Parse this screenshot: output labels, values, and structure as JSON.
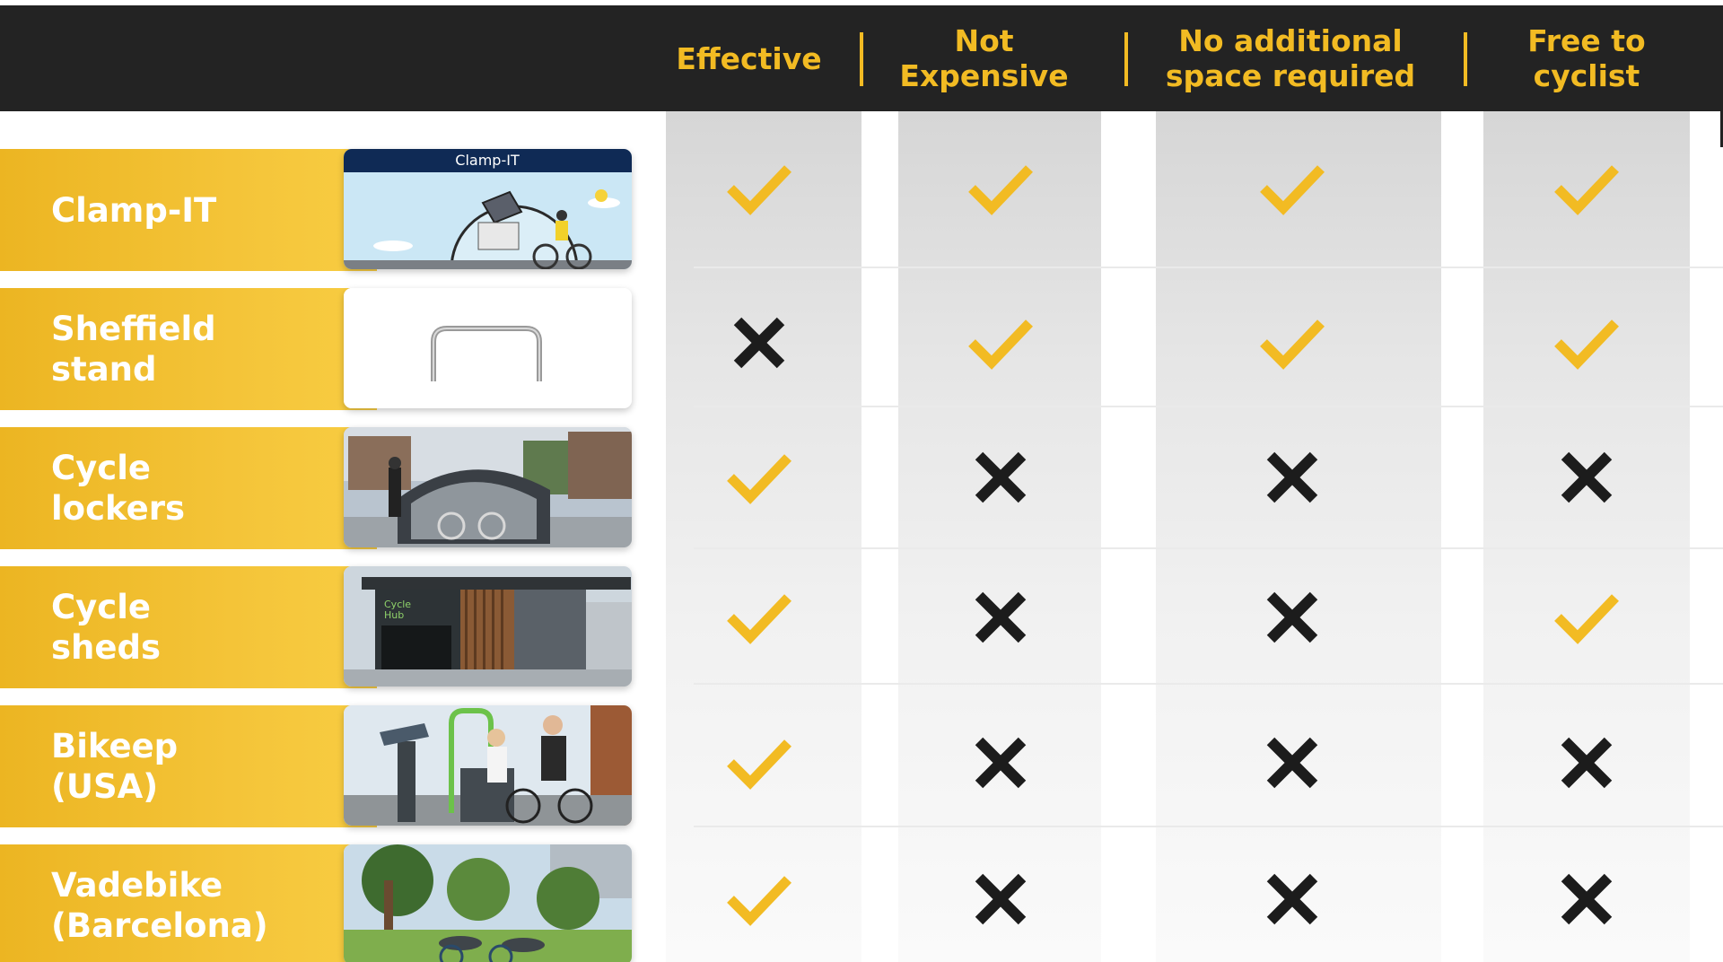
{
  "header": {
    "columns": [
      {
        "label": "Effective"
      },
      {
        "label": "Not\nExpensive"
      },
      {
        "label": "No additional\nspace required"
      },
      {
        "label": "Free to\ncyclist"
      }
    ]
  },
  "colors": {
    "header_bg": "#232323",
    "accent_yellow": "#f2bb23",
    "check": "#f2bb23",
    "cross": "#1c1c1c",
    "label_text": "#ffffff"
  },
  "rows": [
    {
      "label": "Clamp-IT",
      "image_title": "Clamp-IT",
      "image": "clamp-it-illustration",
      "marks": [
        "check",
        "check",
        "check",
        "check"
      ]
    },
    {
      "label": "Sheffield\nstand",
      "image": "sheffield-stand-photo",
      "marks": [
        "cross",
        "check",
        "check",
        "check"
      ]
    },
    {
      "label": "Cycle\nlockers",
      "image": "cycle-lockers-photo",
      "marks": [
        "check",
        "cross",
        "cross",
        "cross"
      ]
    },
    {
      "label": "Cycle\nsheds",
      "image": "cycle-sheds-photo",
      "image_sign": "Cycle\nHub",
      "marks": [
        "check",
        "cross",
        "cross",
        "check"
      ]
    },
    {
      "label": "Bikeep\n(USA)",
      "image": "bikeep-photo",
      "marks": [
        "check",
        "cross",
        "cross",
        "cross"
      ]
    },
    {
      "label": "Vadebike\n(Barcelona)",
      "image": "vadebike-photo",
      "marks": [
        "check",
        "cross",
        "cross",
        "cross"
      ]
    }
  ]
}
